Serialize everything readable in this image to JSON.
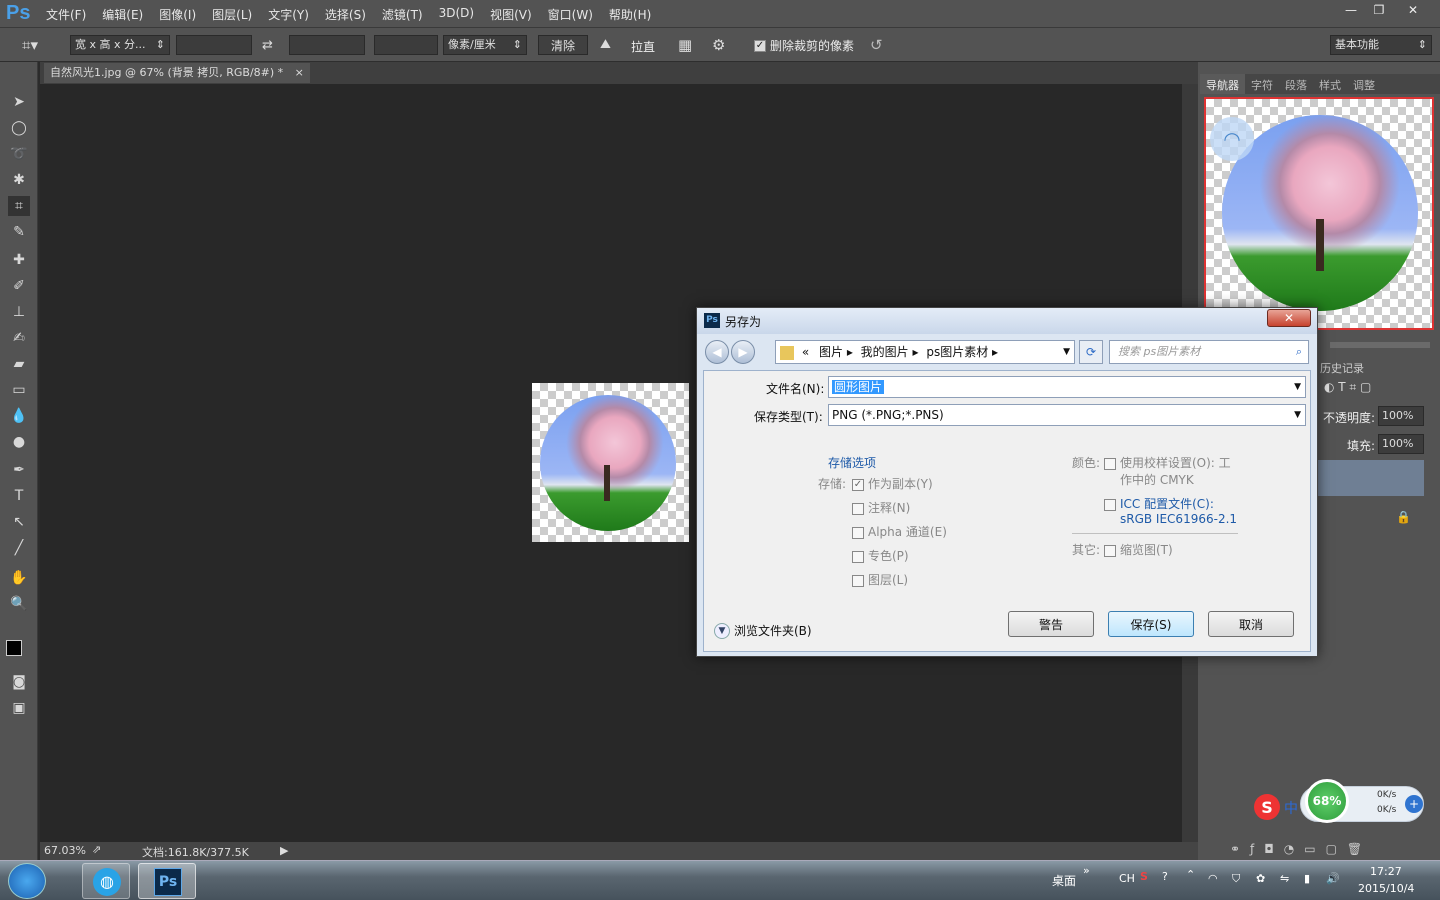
{
  "app": {
    "logo": "Ps",
    "menu": [
      "文件(F)",
      "编辑(E)",
      "图像(I)",
      "图层(L)",
      "文字(Y)",
      "选择(S)",
      "滤镜(T)",
      "3D(D)",
      "视图(V)",
      "窗口(W)",
      "帮助(H)"
    ],
    "win_controls": [
      "—",
      "❐",
      "✕"
    ]
  },
  "options": {
    "ratio_label": "宽 x 高 x 分...",
    "unit_label": "像素/厘米",
    "clear_label": "清除",
    "straighten_label": "拉直",
    "delete_cropped_label": "删除裁剪的像素",
    "delete_cropped_checked": true,
    "workspace_label": "基本功能"
  },
  "document": {
    "tab_title": "自然风光1.jpg @ 67% (背景 拷贝, RGB/8#) *",
    "tab_close": "×"
  },
  "status": {
    "zoom": "67.03%",
    "doc_info": "文档:161.8K/377.5K"
  },
  "panels": {
    "tabs": [
      "导航器",
      "字符",
      "段落",
      "样式",
      "调整"
    ],
    "history_label": "历史记录",
    "opacity_label": "不透明度:",
    "opacity_value": "100%",
    "fill_label": "填充:",
    "fill_value": "100%"
  },
  "dialog": {
    "title": "另存为",
    "title_icon": "Ps",
    "close": "✕",
    "breadcrumb": [
      "«",
      "图片",
      "我的图片",
      "ps图片素材"
    ],
    "search_placeholder": "搜索 ps图片素材",
    "filename_label": "文件名(N):",
    "filename_value": "圆形图片",
    "filetype_label": "保存类型(T):",
    "filetype_value": "PNG (*.PNG;*.PNS)",
    "save_options_label": "存储选项",
    "save_label": "存储:",
    "options": [
      {
        "label": "作为副本(Y)",
        "checked": true
      },
      {
        "label": "注释(N)",
        "checked": false
      },
      {
        "label": "Alpha 通道(E)",
        "checked": false
      },
      {
        "label": "专色(P)",
        "checked": false
      },
      {
        "label": "图层(L)",
        "checked": false
      }
    ],
    "color_label": "颜色:",
    "proof_label": "使用校样设置(O): 工",
    "proof_label2": "作中的 CMYK",
    "icc_label": "ICC 配置文件(C):",
    "icc_value": "sRGB IEC61966-2.1",
    "other_label": "其它:",
    "thumbnail_label": "缩览图(T)",
    "browse_label": "浏览文件夹(B)",
    "buttons": {
      "warning": "警告",
      "save": "保存(S)",
      "cancel": "取消"
    }
  },
  "widget": {
    "percent": "68%",
    "up": "0K/s",
    "down": "0K/s",
    "ime": "中"
  },
  "taskbar": {
    "desktop_label": "桌面",
    "lang": "CH",
    "time": "17:27",
    "date": "2015/10/4"
  }
}
